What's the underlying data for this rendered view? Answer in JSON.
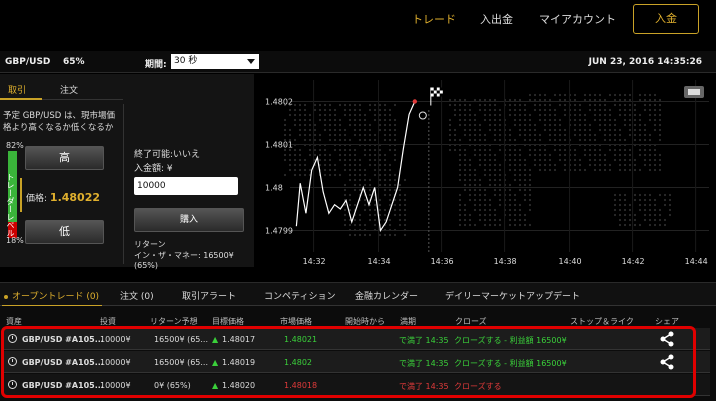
{
  "nav": {
    "trade": "トレード",
    "deposit_withdraw": "入出金",
    "my_account": "マイアカウント",
    "deposit_button": "入金"
  },
  "info": {
    "pair": "GBP/USD",
    "pct": "65%",
    "period_label": "期間:",
    "period_value": "30 秒",
    "datetime": "JUN 23, 2016 14:35:26"
  },
  "trade_panel": {
    "tab_trade": "取引",
    "tab_order": "注文",
    "prediction": "予定 GBP/USD は、現市場価格より高くなるか低くなるか",
    "meter_top": "82%",
    "meter_label": "トレーダーレベル",
    "meter_bottom": "18%",
    "meter_high_fraction": 0.82,
    "high_button": "高",
    "price_label": "価格:",
    "price_value": "1.48022",
    "low_button": "低",
    "expiry": "終了可能:いいえ",
    "amount_label": "入金額: ¥",
    "amount_value": "10000",
    "buy_button": "購入",
    "return_label": "リターン",
    "return_value": "イン・ザ・マネー: 16500¥ (65%)"
  },
  "chart_data": {
    "type": "line",
    "y_ticks": [
      "1.4802",
      "1.4801",
      "1.48",
      "1.4799"
    ],
    "x_ticks": [
      "14:32",
      "14:34",
      "14:36",
      "14:38",
      "14:40",
      "14:42",
      "14:44"
    ],
    "ylim": [
      1.47985,
      1.48025
    ],
    "x": [
      14.524,
      14.526,
      14.529,
      14.532,
      14.535,
      14.538,
      14.541,
      14.544,
      14.547,
      14.55,
      14.553,
      14.556,
      14.559,
      14.562,
      14.565,
      14.568,
      14.571,
      14.574,
      14.577,
      14.58,
      14.583,
      14.586
    ],
    "values": [
      1.47991,
      1.48001,
      1.47994,
      1.48004,
      1.48007,
      1.47999,
      1.47994,
      1.47996,
      1.47995,
      1.47997,
      1.47992,
      1.47996,
      1.48,
      1.47996,
      1.48,
      1.4799,
      1.47992,
      1.47996,
      1.48,
      1.48009,
      1.48017,
      1.4802
    ],
    "grid": true,
    "legend": "none"
  },
  "bottom_tabs": [
    {
      "label": "オープントレード (0)"
    },
    {
      "label": "注文 (0)"
    },
    {
      "label": "取引アラート"
    },
    {
      "label": "コンペティション"
    },
    {
      "label": "金融カレンダー"
    },
    {
      "label": "デイリーマーケットアップデート"
    }
  ],
  "table": {
    "headers": [
      "資産",
      "投資",
      "リターン予想",
      "目標価格",
      "市場価格",
      "開始時から",
      "満期",
      "クローズ",
      "ストップ＆ライク",
      "シェア"
    ],
    "rows": [
      {
        "asset": "GBP/USD #A105...",
        "invest": "10000¥",
        "return": "16500¥ (65...",
        "target_arrow": "▲",
        "target": "1.48017",
        "market": "1.48021",
        "expiry": "で満了 14:35",
        "close": "クローズする - 利益額 16500¥",
        "market_color": "green",
        "close_color": "green"
      },
      {
        "asset": "GBP/USD #A105...",
        "invest": "10000¥",
        "return": "16500¥ (65...",
        "target_arrow": "▲",
        "target": "1.48019",
        "market": "1.4802",
        "expiry": "で満了 14:35",
        "close": "クローズする - 利益額 16500¥",
        "market_color": "green",
        "close_color": "green"
      },
      {
        "asset": "GBP/USD #A105...",
        "invest": "10000¥",
        "return": "0¥ (65%)",
        "target_arrow": "▲",
        "target": "1.48020",
        "market": "1.48018",
        "expiry": "で満了 14:35",
        "close": "クローズする",
        "market_color": "red",
        "close_color": "red"
      }
    ]
  }
}
